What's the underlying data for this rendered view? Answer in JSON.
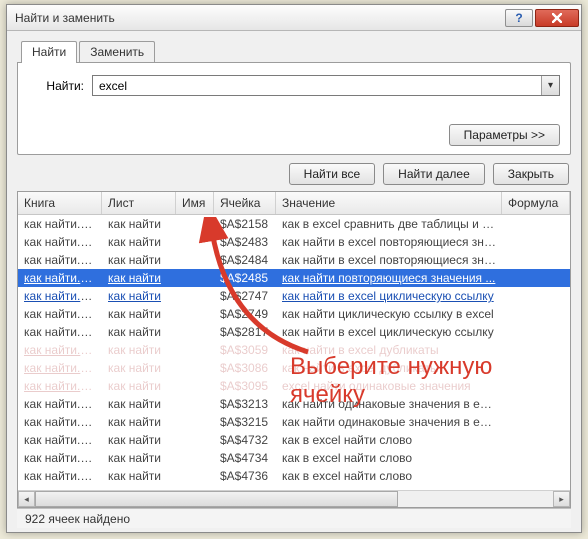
{
  "window": {
    "title": "Найти и заменить"
  },
  "tabs": {
    "find": "Найти",
    "replace": "Заменить"
  },
  "find": {
    "label": "Найти:",
    "value": "excel"
  },
  "buttons": {
    "options": "Параметры >>",
    "find_all": "Найти все",
    "find_next": "Найти далее",
    "close": "Закрыть"
  },
  "columns": {
    "book": "Книга",
    "sheet": "Лист",
    "name": "Имя",
    "cell": "Ячейка",
    "value": "Значение",
    "formula": "Формула"
  },
  "rows": [
    {
      "book": "как найти.csv",
      "sheet": "как найти",
      "cell": "$A$2158",
      "value": "как в excel сравнить две таблицы и н...",
      "link": false,
      "sel": false,
      "faded": false
    },
    {
      "book": "как найти.csv",
      "sheet": "как найти",
      "cell": "$A$2483",
      "value": "как найти в excel повторяющиеся зна...",
      "link": false,
      "sel": false,
      "faded": false
    },
    {
      "book": "как найти.csv",
      "sheet": "как найти",
      "cell": "$A$2484",
      "value": "как найти в excel повторяющиеся зна...",
      "link": false,
      "sel": false,
      "faded": false
    },
    {
      "book": "как найти.csv",
      "sheet": "как найти",
      "cell": "$A$2485",
      "value": "как найти повторяющиеся значения ...",
      "link": true,
      "sel": true,
      "faded": false
    },
    {
      "book": "как найти.csv",
      "sheet": "как найти",
      "cell": "$A$2747",
      "value": "как найти в excel циклическую ссылку",
      "link": true,
      "sel": false,
      "faded": false
    },
    {
      "book": "как найти.csv",
      "sheet": "как найти",
      "cell": "$A$2749",
      "value": "как найти циклическую ссылку в excel",
      "link": false,
      "sel": false,
      "faded": false
    },
    {
      "book": "как найти.csv",
      "sheet": "как найти",
      "cell": "$A$2817",
      "value": "как найти в excel циклическую ссылку",
      "link": false,
      "sel": false,
      "faded": false
    },
    {
      "book": "как найти.csv",
      "sheet": "как найти",
      "cell": "$A$3059",
      "value": "как найти в excel дубликаты",
      "link": true,
      "sel": false,
      "faded": true
    },
    {
      "book": "как найти.csv",
      "sheet": "как найти",
      "cell": "$A$3086",
      "value": "как найти в excel дубликаты",
      "link": true,
      "sel": false,
      "faded": true
    },
    {
      "book": "как найти.csv",
      "sheet": "как найти",
      "cell": "$A$3095",
      "value": "excel найти одинаковые значения",
      "link": true,
      "sel": false,
      "faded": true
    },
    {
      "book": "как найти.csv",
      "sheet": "как найти",
      "cell": "$A$3213",
      "value": "как найти одинаковые значения в excel",
      "link": false,
      "sel": false,
      "faded": false
    },
    {
      "book": "как найти.csv",
      "sheet": "как найти",
      "cell": "$A$3215",
      "value": "как найти одинаковые значения в excel",
      "link": false,
      "sel": false,
      "faded": false
    },
    {
      "book": "как найти.csv",
      "sheet": "как найти",
      "cell": "$A$4732",
      "value": "как в excel найти слово",
      "link": false,
      "sel": false,
      "faded": false
    },
    {
      "book": "как найти.csv",
      "sheet": "как найти",
      "cell": "$A$4734",
      "value": "как в excel найти слово",
      "link": false,
      "sel": false,
      "faded": false
    },
    {
      "book": "как найти.csv",
      "sheet": "как найти",
      "cell": "$A$4736",
      "value": "как в excel найти слово",
      "link": false,
      "sel": false,
      "faded": false
    }
  ],
  "status": "922 ячеек найдено",
  "annotation": {
    "line1": "Выберите нужную",
    "line2": "ячейку"
  }
}
